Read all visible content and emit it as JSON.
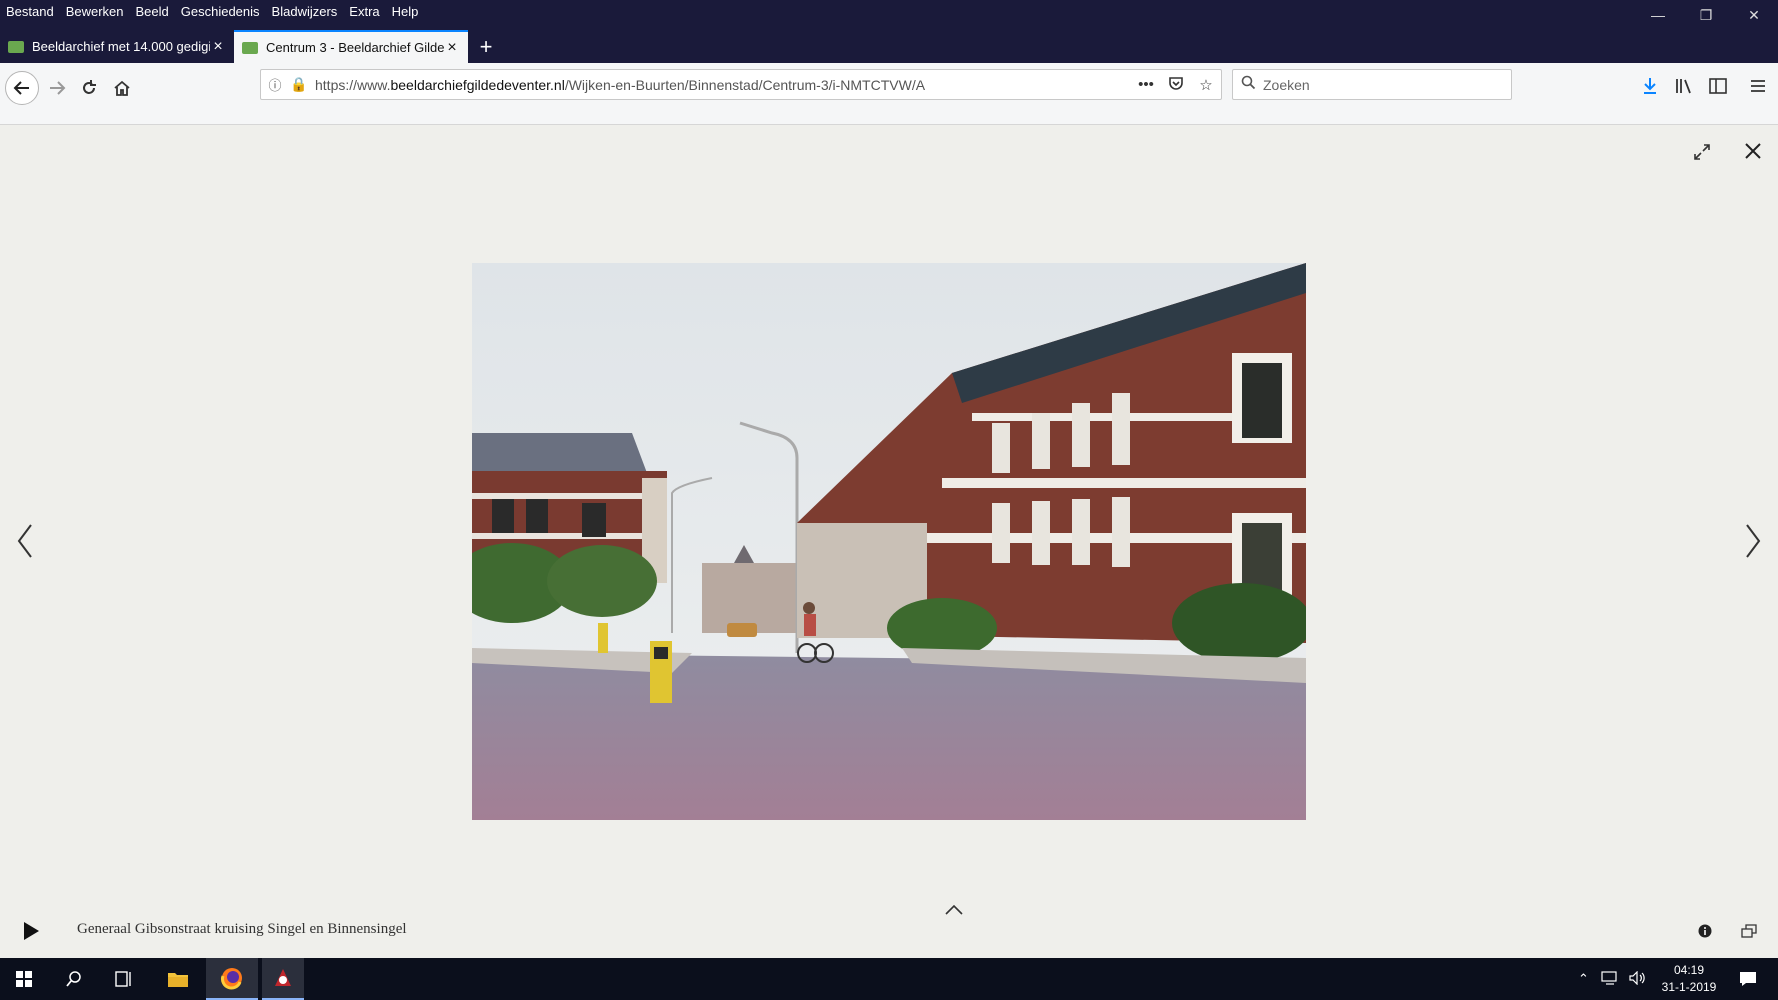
{
  "menubar": [
    "Bestand",
    "Bewerken",
    "Beeld",
    "Geschiedenis",
    "Bladwijzers",
    "Extra",
    "Help"
  ],
  "tabs": [
    {
      "title": "Beeldarchief met 14.000 gedigi",
      "active": false
    },
    {
      "title": "Centrum 3 - Beeldarchief Gilde",
      "active": true
    }
  ],
  "urlbar": {
    "prefix": "https://www.",
    "host": "beeldarchiefgildedeventer.nl",
    "path": "/Wijken-en-Buurten/Binnenstad/Centrum-3/i-NMTCTVW/A"
  },
  "search": {
    "placeholder": "Zoeken"
  },
  "viewer": {
    "caption": "Generaal Gibsonstraat kruising Singel en Binnensingel"
  },
  "taskbar": {
    "time": "04:19",
    "date": "31-1-2019"
  },
  "colors": {
    "accent": "#0a84ff",
    "titlebar": "#1a1a3a",
    "lock": "#12bc00"
  }
}
